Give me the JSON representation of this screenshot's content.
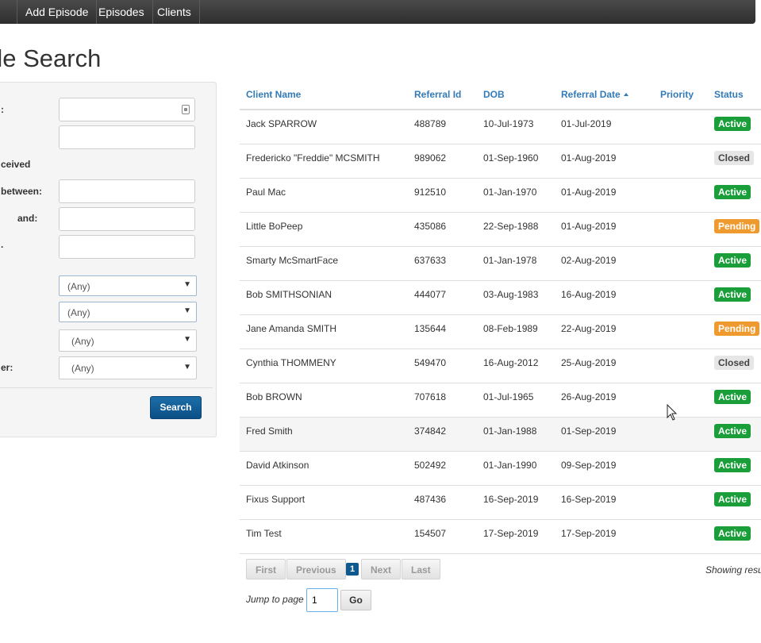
{
  "nav": {
    "items": [
      "Add Episode",
      "Episodes",
      "Clients"
    ]
  },
  "page": {
    "title": "de Search"
  },
  "filters": {
    "labels": [
      ":",
      "ceived",
      "between:",
      "and:",
      ".",
      "er:"
    ],
    "selects": [
      "(Any)",
      "(Any)",
      "(Any)",
      "(Any)"
    ],
    "search_label": "Search"
  },
  "table": {
    "headers": [
      "Client Name",
      "Referral Id",
      "DOB",
      "Referral Date",
      "Priority",
      "Status"
    ],
    "rows": [
      {
        "name": "Jack SPARROW",
        "id": "488789",
        "dob": "10-Jul-1973",
        "date": "01-Jul-2019",
        "status": "Active"
      },
      {
        "name": "Fredericko \"Freddie\" MCSMITH",
        "id": "989062",
        "dob": "01-Sep-1960",
        "date": "01-Aug-2019",
        "status": "Closed"
      },
      {
        "name": "Paul Mac",
        "id": "912510",
        "dob": "01-Jan-1970",
        "date": "01-Aug-2019",
        "status": "Active"
      },
      {
        "name": "Little BoPeep",
        "id": "435086",
        "dob": "22-Sep-1988",
        "date": "01-Aug-2019",
        "status": "Pending"
      },
      {
        "name": "Smarty McSmartFace",
        "id": "637633",
        "dob": "01-Jan-1978",
        "date": "02-Aug-2019",
        "status": "Active"
      },
      {
        "name": "Bob SMITHSONIAN",
        "id": "444077",
        "dob": "03-Aug-1983",
        "date": "16-Aug-2019",
        "status": "Active"
      },
      {
        "name": "Jane Amanda SMITH",
        "id": "135644",
        "dob": "08-Feb-1989",
        "date": "22-Aug-2019",
        "status": "Pending"
      },
      {
        "name": "Cynthia THOMMENY",
        "id": "549470",
        "dob": "16-Aug-2012",
        "date": "25-Aug-2019",
        "status": "Closed"
      },
      {
        "name": "Bob BROWN",
        "id": "707618",
        "dob": "01-Jul-1965",
        "date": "26-Aug-2019",
        "status": "Active"
      },
      {
        "name": "Fred Smith",
        "id": "374842",
        "dob": "01-Jan-1988",
        "date": "01-Sep-2019",
        "status": "Active"
      },
      {
        "name": "David Atkinson",
        "id": "502492",
        "dob": "01-Jan-1990",
        "date": "09-Sep-2019",
        "status": "Active"
      },
      {
        "name": "Fixus Support",
        "id": "487436",
        "dob": "16-Sep-2019",
        "date": "16-Sep-2019",
        "status": "Active"
      },
      {
        "name": "Tim Test",
        "id": "154507",
        "dob": "17-Sep-2019",
        "date": "17-Sep-2019",
        "status": "Active"
      }
    ]
  },
  "pager": {
    "first": "First",
    "previous": "Previous",
    "current": "1",
    "next": "Next",
    "last": "Last",
    "showing": "Showing resu",
    "jump_label": "Jump to page",
    "jump_value": "1",
    "go": "Go"
  }
}
